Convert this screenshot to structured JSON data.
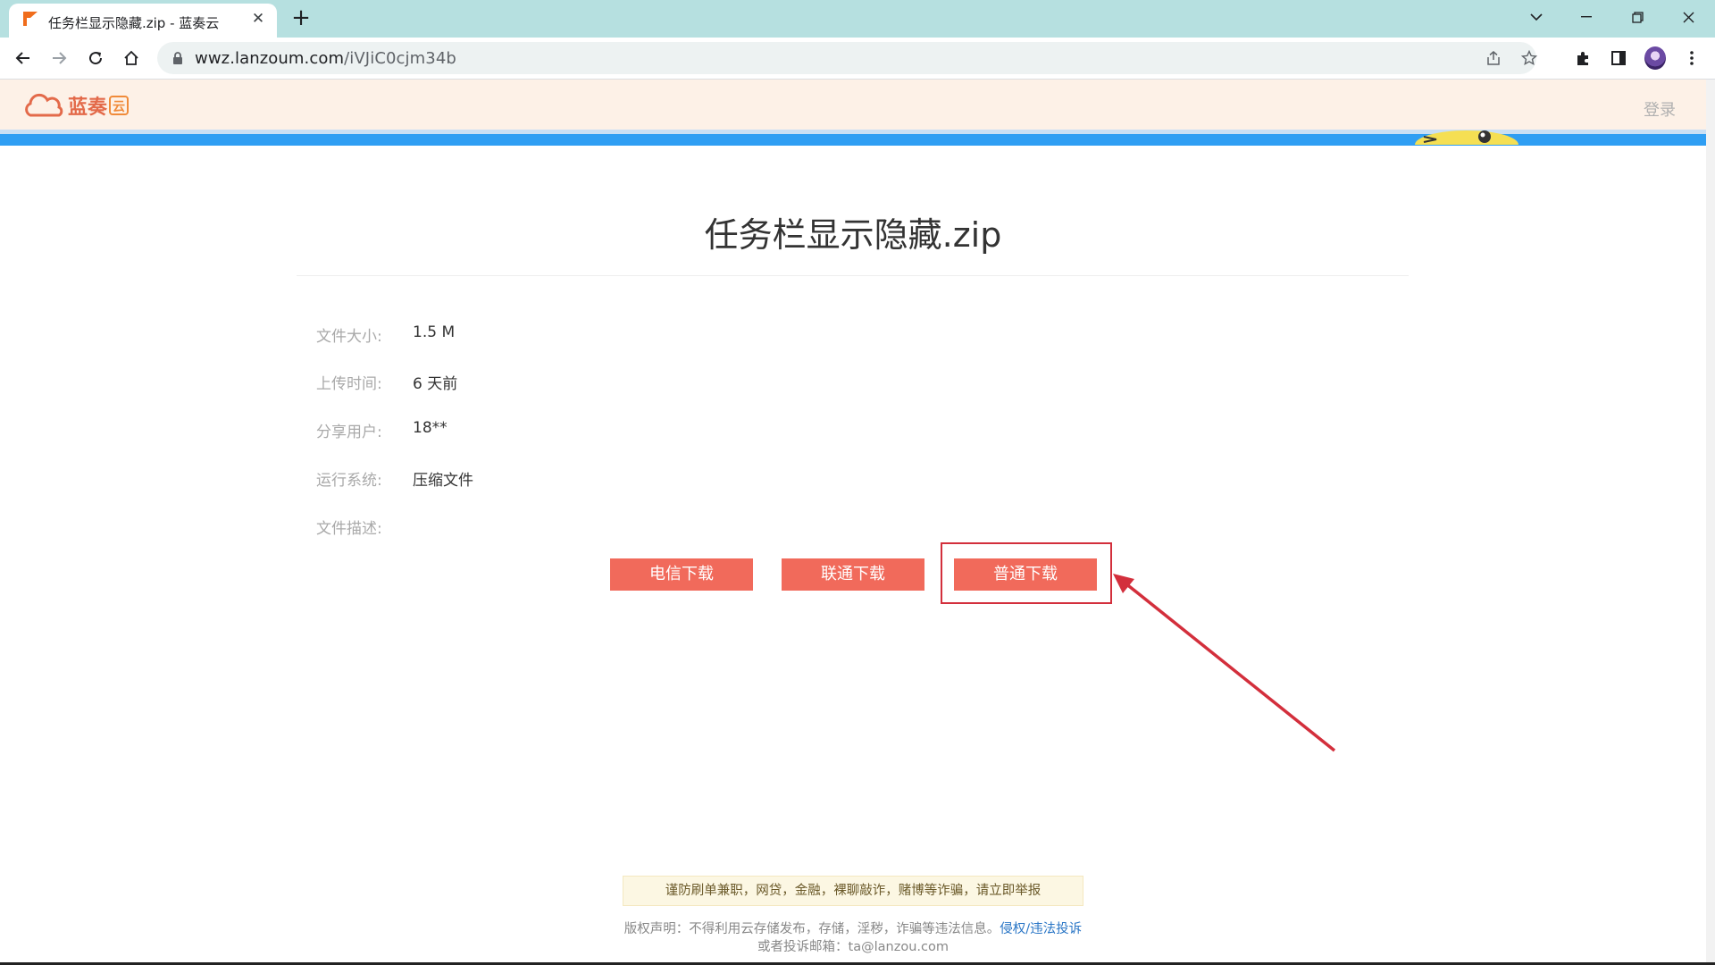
{
  "browser": {
    "tab_title": "任务栏显示隐藏.zip - 蓝奏云",
    "url_host": "wwz.lanzoum.com",
    "url_path": "/iVJiC0cjm34b"
  },
  "site": {
    "logo_text": "蓝奏",
    "logo_badge": "云",
    "login_label": "登录",
    "brand_color": "#f16a5b",
    "accent_blue": "#2f9ef3"
  },
  "file": {
    "title": "任务栏显示隐藏.zip",
    "info": [
      {
        "label": "文件大小:",
        "value": "1.5 M"
      },
      {
        "label": "上传时间:",
        "value": "6 天前"
      },
      {
        "label": "分享用户:",
        "value": "18**"
      },
      {
        "label": "运行系统:",
        "value": "压缩文件"
      },
      {
        "label": "文件描述:",
        "value": ""
      }
    ]
  },
  "downloads": [
    {
      "label": "电信下载"
    },
    {
      "label": "联通下载"
    },
    {
      "label": "普通下载"
    }
  ],
  "annotation": {
    "color": "#d32f3c",
    "icon": "red-arrow-icon"
  },
  "footer": {
    "warning": "谨防刷单兼职，网贷，金融，裸聊敲诈，赌博等诈骗，请立即举报",
    "copyright": "版权声明：不得利用云存储发布，存储，淫秽，诈骗等违法信息。",
    "report_link": "侵权/违法投诉",
    "email_line": "或者投诉邮箱：ta@lanzou.com"
  }
}
